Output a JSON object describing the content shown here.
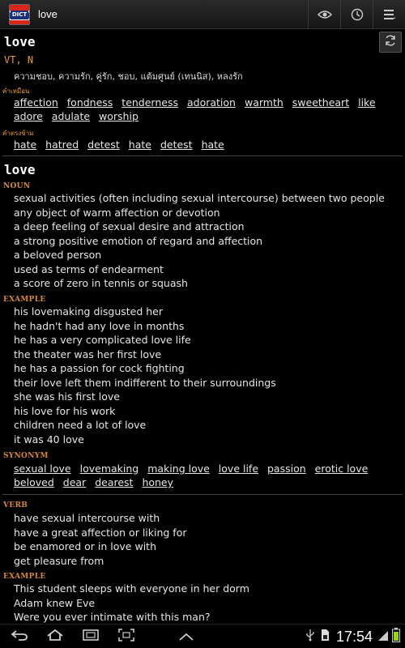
{
  "app": {
    "title": "love",
    "icon_label": "DICT"
  },
  "toolbar": {
    "icons": [
      "eye-icon",
      "history-icon",
      "menu-icon"
    ]
  },
  "entry1": {
    "headword": "love",
    "pos": "VT, N",
    "thai": "ความชอบ, ความรัก, คู่รัก, ชอบ, แต้มศูนย์ (เทนนิส), หลงรัก",
    "synonyms_label": "คำเหมือน",
    "synonyms": [
      "affection",
      "fondness",
      "tenderness",
      "adoration",
      "warmth",
      "sweetheart",
      "like",
      "adore",
      "adulate",
      "worship"
    ],
    "antonyms_label": "คำตรงข้าม",
    "antonyms": [
      "hate",
      "hatred",
      "detest",
      "hate",
      "detest",
      "hate"
    ]
  },
  "entry2": {
    "headword": "love",
    "noun_label": "NOUN",
    "noun_defs": [
      "sexual activities (often including sexual intercourse) between two people",
      "any object of warm affection or devotion",
      "a deep feeling of sexual desire and attraction",
      "a strong positive emotion of regard and affection",
      "a beloved person",
      "used as terms of endearment",
      "a score of zero in tennis or squash"
    ],
    "example_label": "EXAMPLE",
    "noun_examples": [
      "his lovemaking disgusted her",
      "he hadn't had any love in months",
      "he has a very complicated love life",
      "the theater was her first love",
      "he has a passion for cock fighting",
      "their love left them indifferent to their surroundings",
      "she was his first love",
      "his love for his work",
      "children need a lot of love",
      "it was 40 love"
    ],
    "synonym_label": "SYNONYM",
    "noun_synonyms": [
      "sexual love",
      "lovemaking",
      "making love",
      "love life",
      "passion",
      "erotic love",
      "beloved",
      "dear",
      "dearest",
      "honey"
    ],
    "verb_label": "VERB",
    "verb_defs": [
      "have sexual intercourse with",
      "have a great affection or liking for",
      "be enamored or in love with",
      "get pleasure from"
    ],
    "verb_example_label": "EXAMPLE",
    "verb_examples": [
      "This student sleeps with everyone in her dorm",
      "Adam knew Eve",
      "Were you ever intimate with this man?"
    ]
  },
  "status": {
    "time": "17:54"
  },
  "colors": {
    "accent_orange": "#e8a020",
    "section_label": "#d88a30"
  }
}
